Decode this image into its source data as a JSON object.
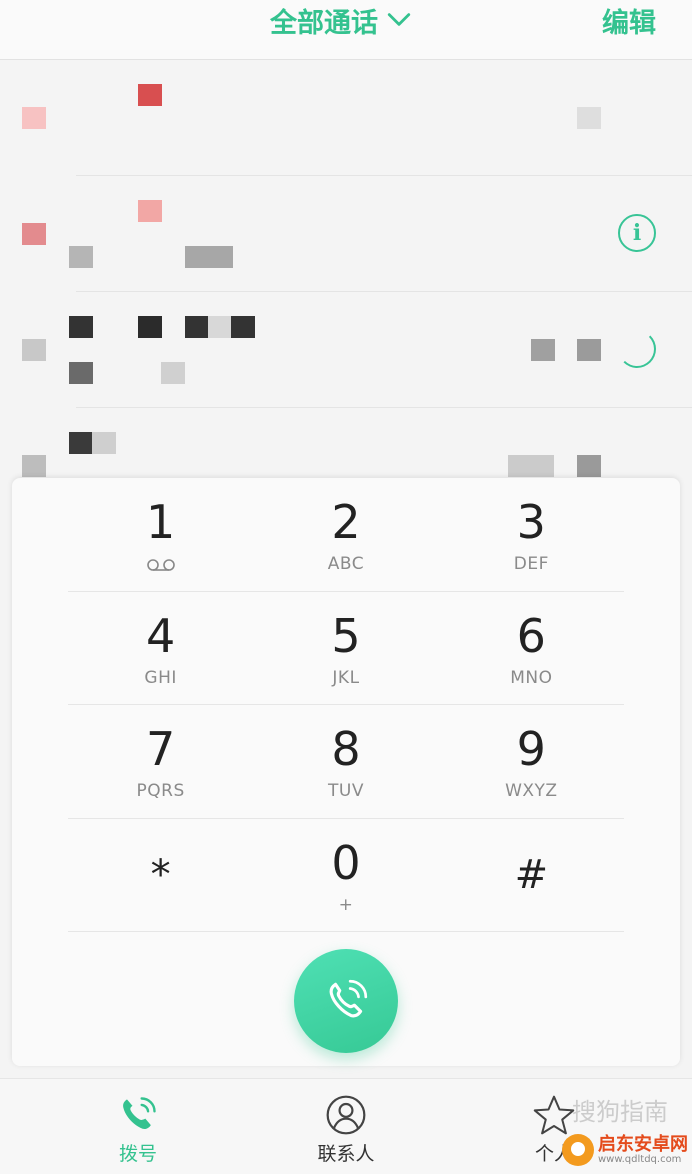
{
  "header": {
    "filter_label": "全部通话",
    "edit_label": "编辑"
  },
  "dialpad": {
    "rows": [
      [
        {
          "digit": "1",
          "letters": ""
        },
        {
          "digit": "2",
          "letters": "ABC"
        },
        {
          "digit": "3",
          "letters": "DEF"
        }
      ],
      [
        {
          "digit": "4",
          "letters": "GHI"
        },
        {
          "digit": "5",
          "letters": "JKL"
        },
        {
          "digit": "6",
          "letters": "MNO"
        }
      ],
      [
        {
          "digit": "7",
          "letters": "PQRS"
        },
        {
          "digit": "8",
          "letters": "TUV"
        },
        {
          "digit": "9",
          "letters": "WXYZ"
        }
      ],
      [
        {
          "digit": "*",
          "letters": ""
        },
        {
          "digit": "0",
          "letters": "+"
        },
        {
          "digit": "#",
          "letters": ""
        }
      ]
    ]
  },
  "bottom_nav": {
    "items": [
      {
        "label": "拨号",
        "icon": "phone-icon",
        "active": true
      },
      {
        "label": "联系人",
        "icon": "contacts-icon",
        "active": false
      },
      {
        "label": "个人",
        "icon": "star-icon",
        "active": false
      }
    ]
  },
  "watermark": {
    "text": "搜狗指南",
    "logo_name": "启东安卓网",
    "logo_url": "www.qdltdq.com"
  },
  "colors": {
    "accent": "#34c28f",
    "call_button": "#3fd2a1"
  }
}
